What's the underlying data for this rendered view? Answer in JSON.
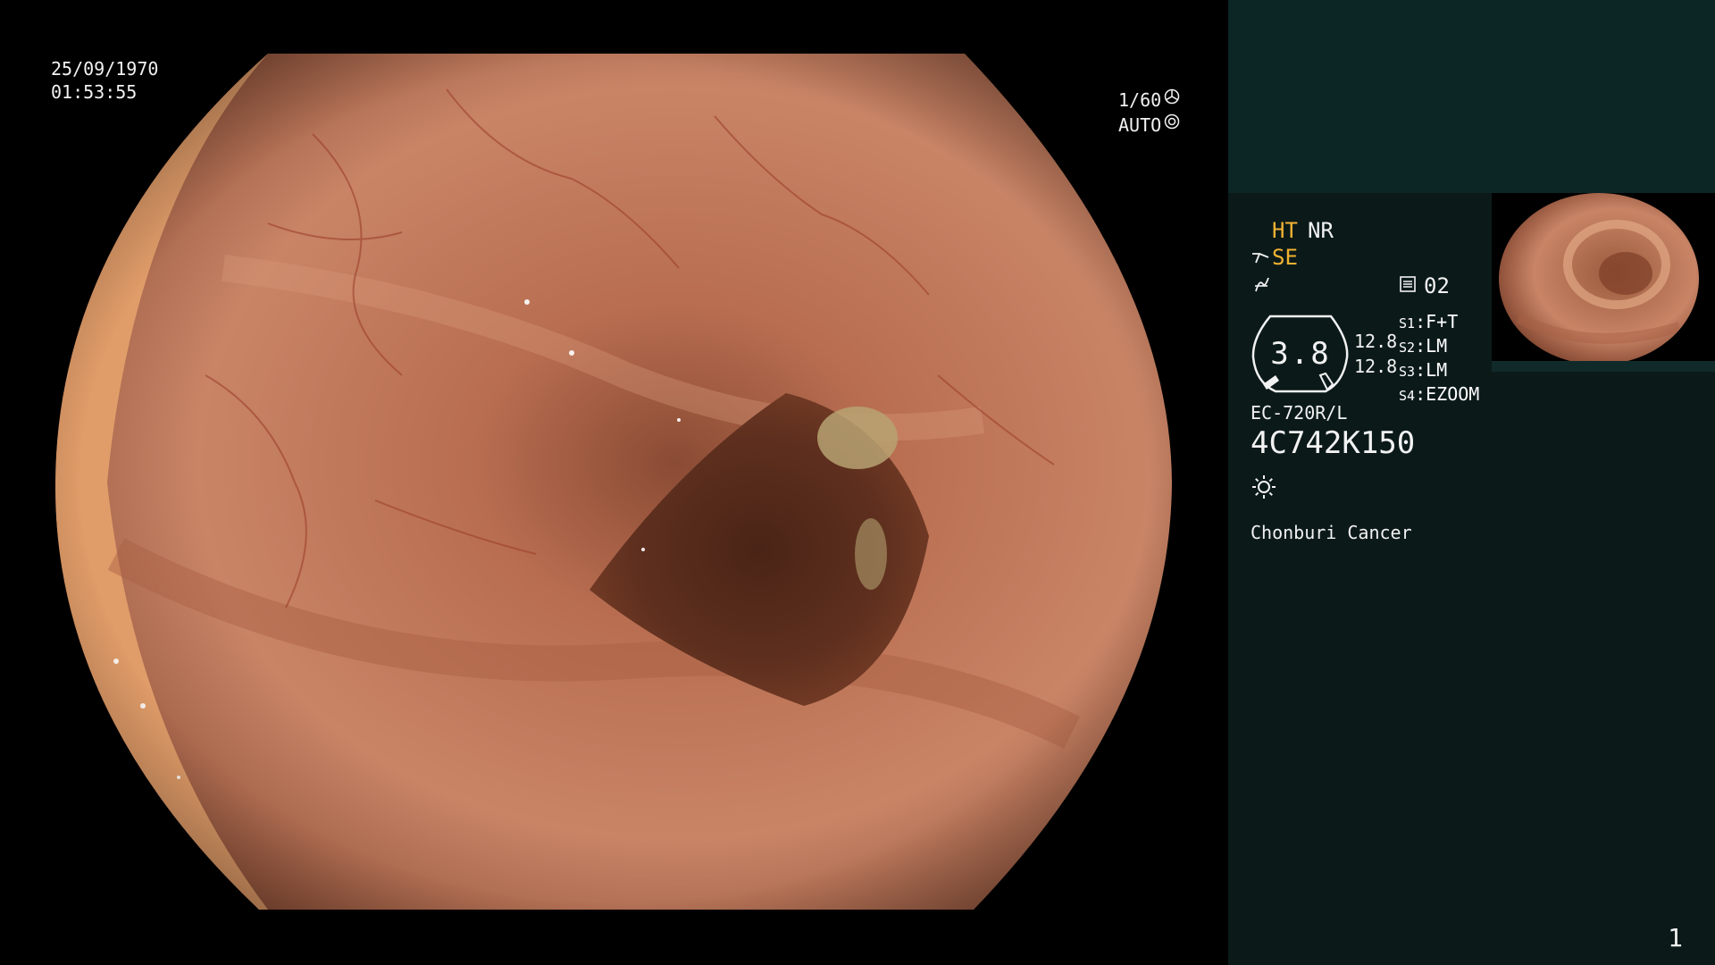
{
  "overlay": {
    "date": "25/09/1970",
    "time": "01:53:55",
    "shutter_speed": "1/60",
    "exposure_mode": "AUTO",
    "shutter_icon": "aperture-icon",
    "exposure_icon": "iris-icon"
  },
  "panel": {
    "ht": "HT",
    "nr": "NR",
    "se": "SE",
    "se_icon": "structure-enhance-icon",
    "color_icon": "color-enhance-icon",
    "memory_icon": "memory-icon",
    "memory_value": "02",
    "gauge_value": "3.8",
    "zoom_top": "12.8",
    "zoom_bottom": "12.8",
    "switches": [
      {
        "key": "S1",
        "value": "F+T"
      },
      {
        "key": "S2",
        "value": "LM"
      },
      {
        "key": "S3",
        "value": "LM"
      },
      {
        "key": "S4",
        "value": "EZOOM"
      }
    ],
    "scope_model": "EC-720R/L",
    "serial": "4C742K150",
    "light_icon": "light-source-icon",
    "institution": "Chonburi Cancer",
    "page_number": "1"
  },
  "colors": {
    "accent_yellow": "#f2b233",
    "panel_top": "#0c2525",
    "panel_main": "#0b1a19",
    "tissue": "#c47a5a"
  }
}
